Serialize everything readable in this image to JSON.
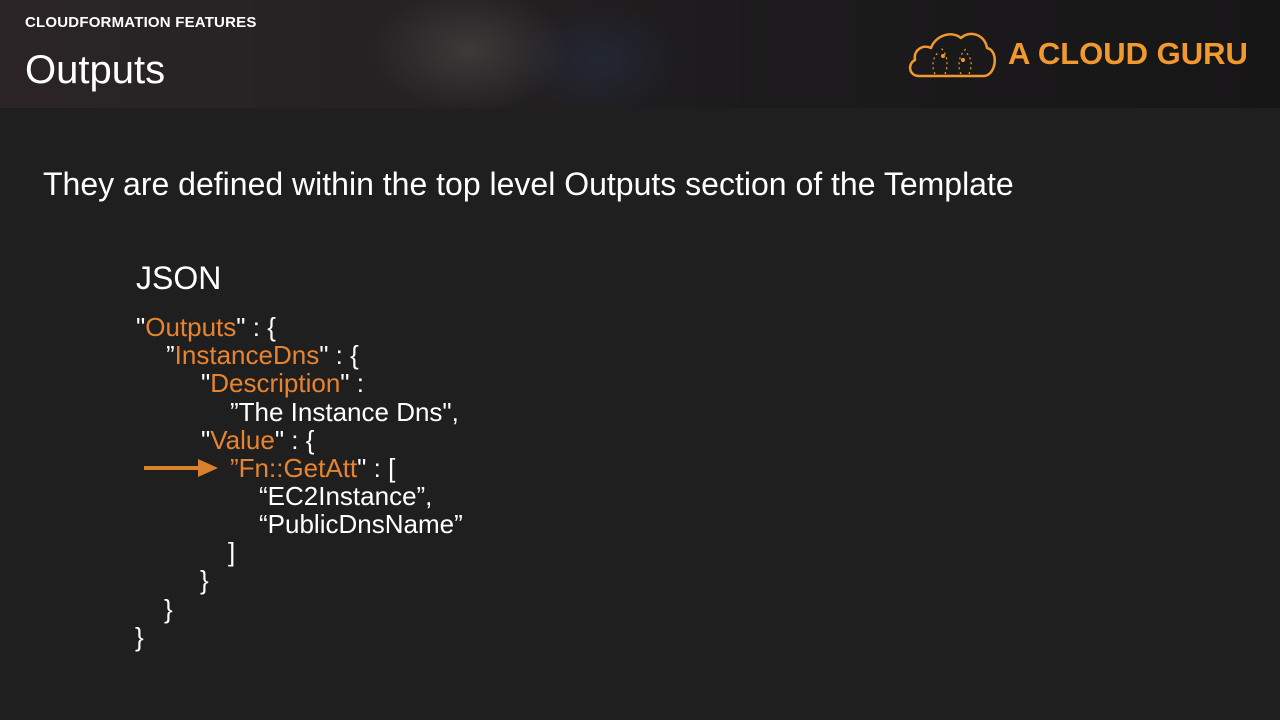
{
  "header": {
    "section_label": "CLOUDFORMATION FEATURES",
    "title": "Outputs",
    "brand_name": "A CLOUD GURU",
    "logo_icon": "cloud-logo-icon",
    "accent_color": "#f2992e"
  },
  "content": {
    "subtitle": "They are defined within the top level Outputs section of the Template",
    "json_heading": "JSON",
    "arrow_icon": "right-arrow-icon",
    "code": {
      "l1_q1": "\"",
      "l1_key": "Outputs",
      "l1_rest": "\" : {",
      "l2_q1": "”",
      "l2_key": "InstanceDns",
      "l2_rest": "\" : {",
      "l3_q1": "\"",
      "l3_key": "Description",
      "l3_rest": "\" :",
      "l4_text": "”The Instance Dns\",",
      "l5_q1": "\"",
      "l5_key": "Value",
      "l5_rest": "\" : {",
      "l6_q1": "”",
      "l6_key": "Fn::GetAtt",
      "l6_rest": "\" : [",
      "l7_text": "“EC2Instance”,",
      "l8_text": "“PublicDnsName”",
      "l9_text": "]",
      "l10_text": "}",
      "l11_text": "}",
      "l12_text": "}"
    }
  }
}
